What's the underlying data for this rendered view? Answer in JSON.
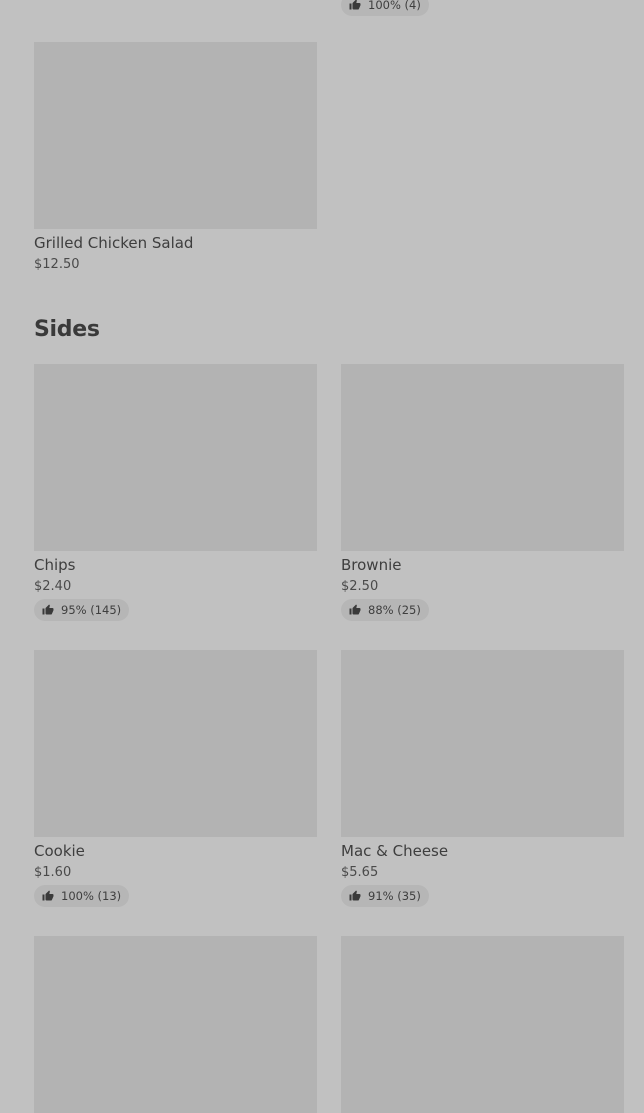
{
  "top_partial": {
    "rating_label": "100% (4)"
  },
  "grilled_chicken_salad": {
    "name": "Grilled Chicken Salad",
    "price": "$12.50"
  },
  "sides": {
    "title": "Sides",
    "items": [
      {
        "name": "Chips",
        "price": "$2.40",
        "rating_label": "95% (145)"
      },
      {
        "name": "Brownie",
        "price": "$2.50",
        "rating_label": "88% (25)"
      },
      {
        "name": "Cookie",
        "price": "$1.60",
        "rating_label": "100% (13)"
      },
      {
        "name": "Mac & Cheese",
        "price": "$5.65",
        "rating_label": "91% (35)"
      }
    ]
  },
  "icons": {
    "rating": "thumbs-up-icon"
  },
  "colors": {
    "background": "#c1c1c1",
    "image_placeholder": "#b3b3b3",
    "badge_background": "#b6b6b6",
    "text": "#3e3e3e"
  }
}
